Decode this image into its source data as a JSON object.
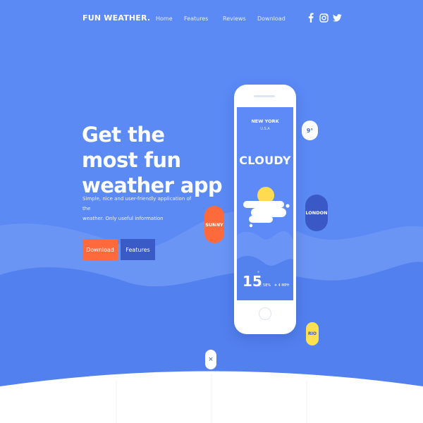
{
  "brand": {
    "logo": "FUN WEATHER."
  },
  "nav": {
    "items": [
      "Home",
      "Features",
      "Reviews",
      "Download"
    ]
  },
  "social": [
    "facebook-icon",
    "instagram-icon",
    "twitter-icon"
  ],
  "hero": {
    "headline_line1": "Get the most fun",
    "headline_line2": "weather app",
    "description_line1": "Simple, nice and user-friendly application of the",
    "description_line2": "weather. Only useful information",
    "download_label": "Download",
    "features_label": "Features"
  },
  "phone": {
    "city": "NEW YORK",
    "country": "U.S.A",
    "condition": "CLOUDY",
    "temperature": "15",
    "degree": "°",
    "humidity": "58%",
    "wind": "4 MPH"
  },
  "bubbles": {
    "temp": "9°",
    "london": "LONDON",
    "sunny": "SUNNY",
    "rio": "RIO"
  },
  "colors": {
    "background": "#5b8af5",
    "accent_orange": "#ff6a3d",
    "accent_blue": "#3a5bc6",
    "london_blue": "#3b59c6",
    "sun_yellow": "#ffdc4f",
    "rio_yellow": "#ffe14f"
  }
}
